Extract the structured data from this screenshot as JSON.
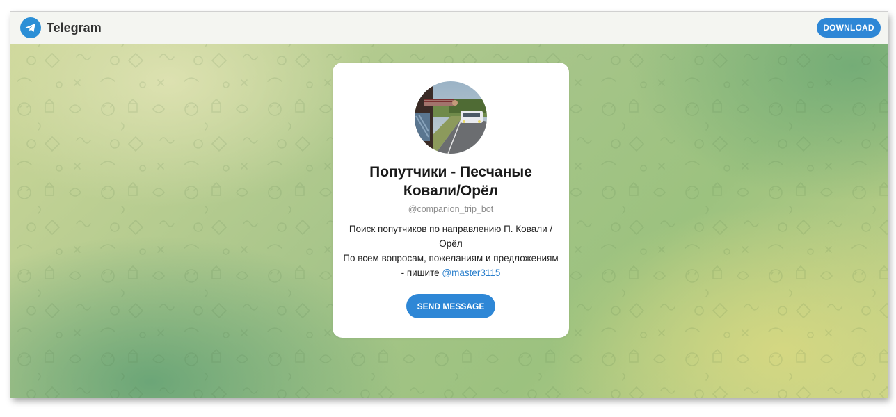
{
  "header": {
    "app_name": "Telegram",
    "download_label": "DOWNLOAD"
  },
  "card": {
    "title": "Попутчики - Песчаные Ковали/Орёл",
    "username": "@companion_trip_bot",
    "description_line1": "Поиск попутчиков по направлению П. Ковали / Орёл",
    "description_line2": "По всем вопросам, пожеланиям и предложениям - пишите ",
    "description_link": "@master3115",
    "send_label": "SEND MESSAGE"
  },
  "colors": {
    "accent": "#2e87d6",
    "header_bg": "#f4f5f1",
    "link": "#2a7fcc"
  },
  "icons": {
    "logo": "telegram-plane-icon",
    "avatar": "hitchhiker-road-photo"
  }
}
